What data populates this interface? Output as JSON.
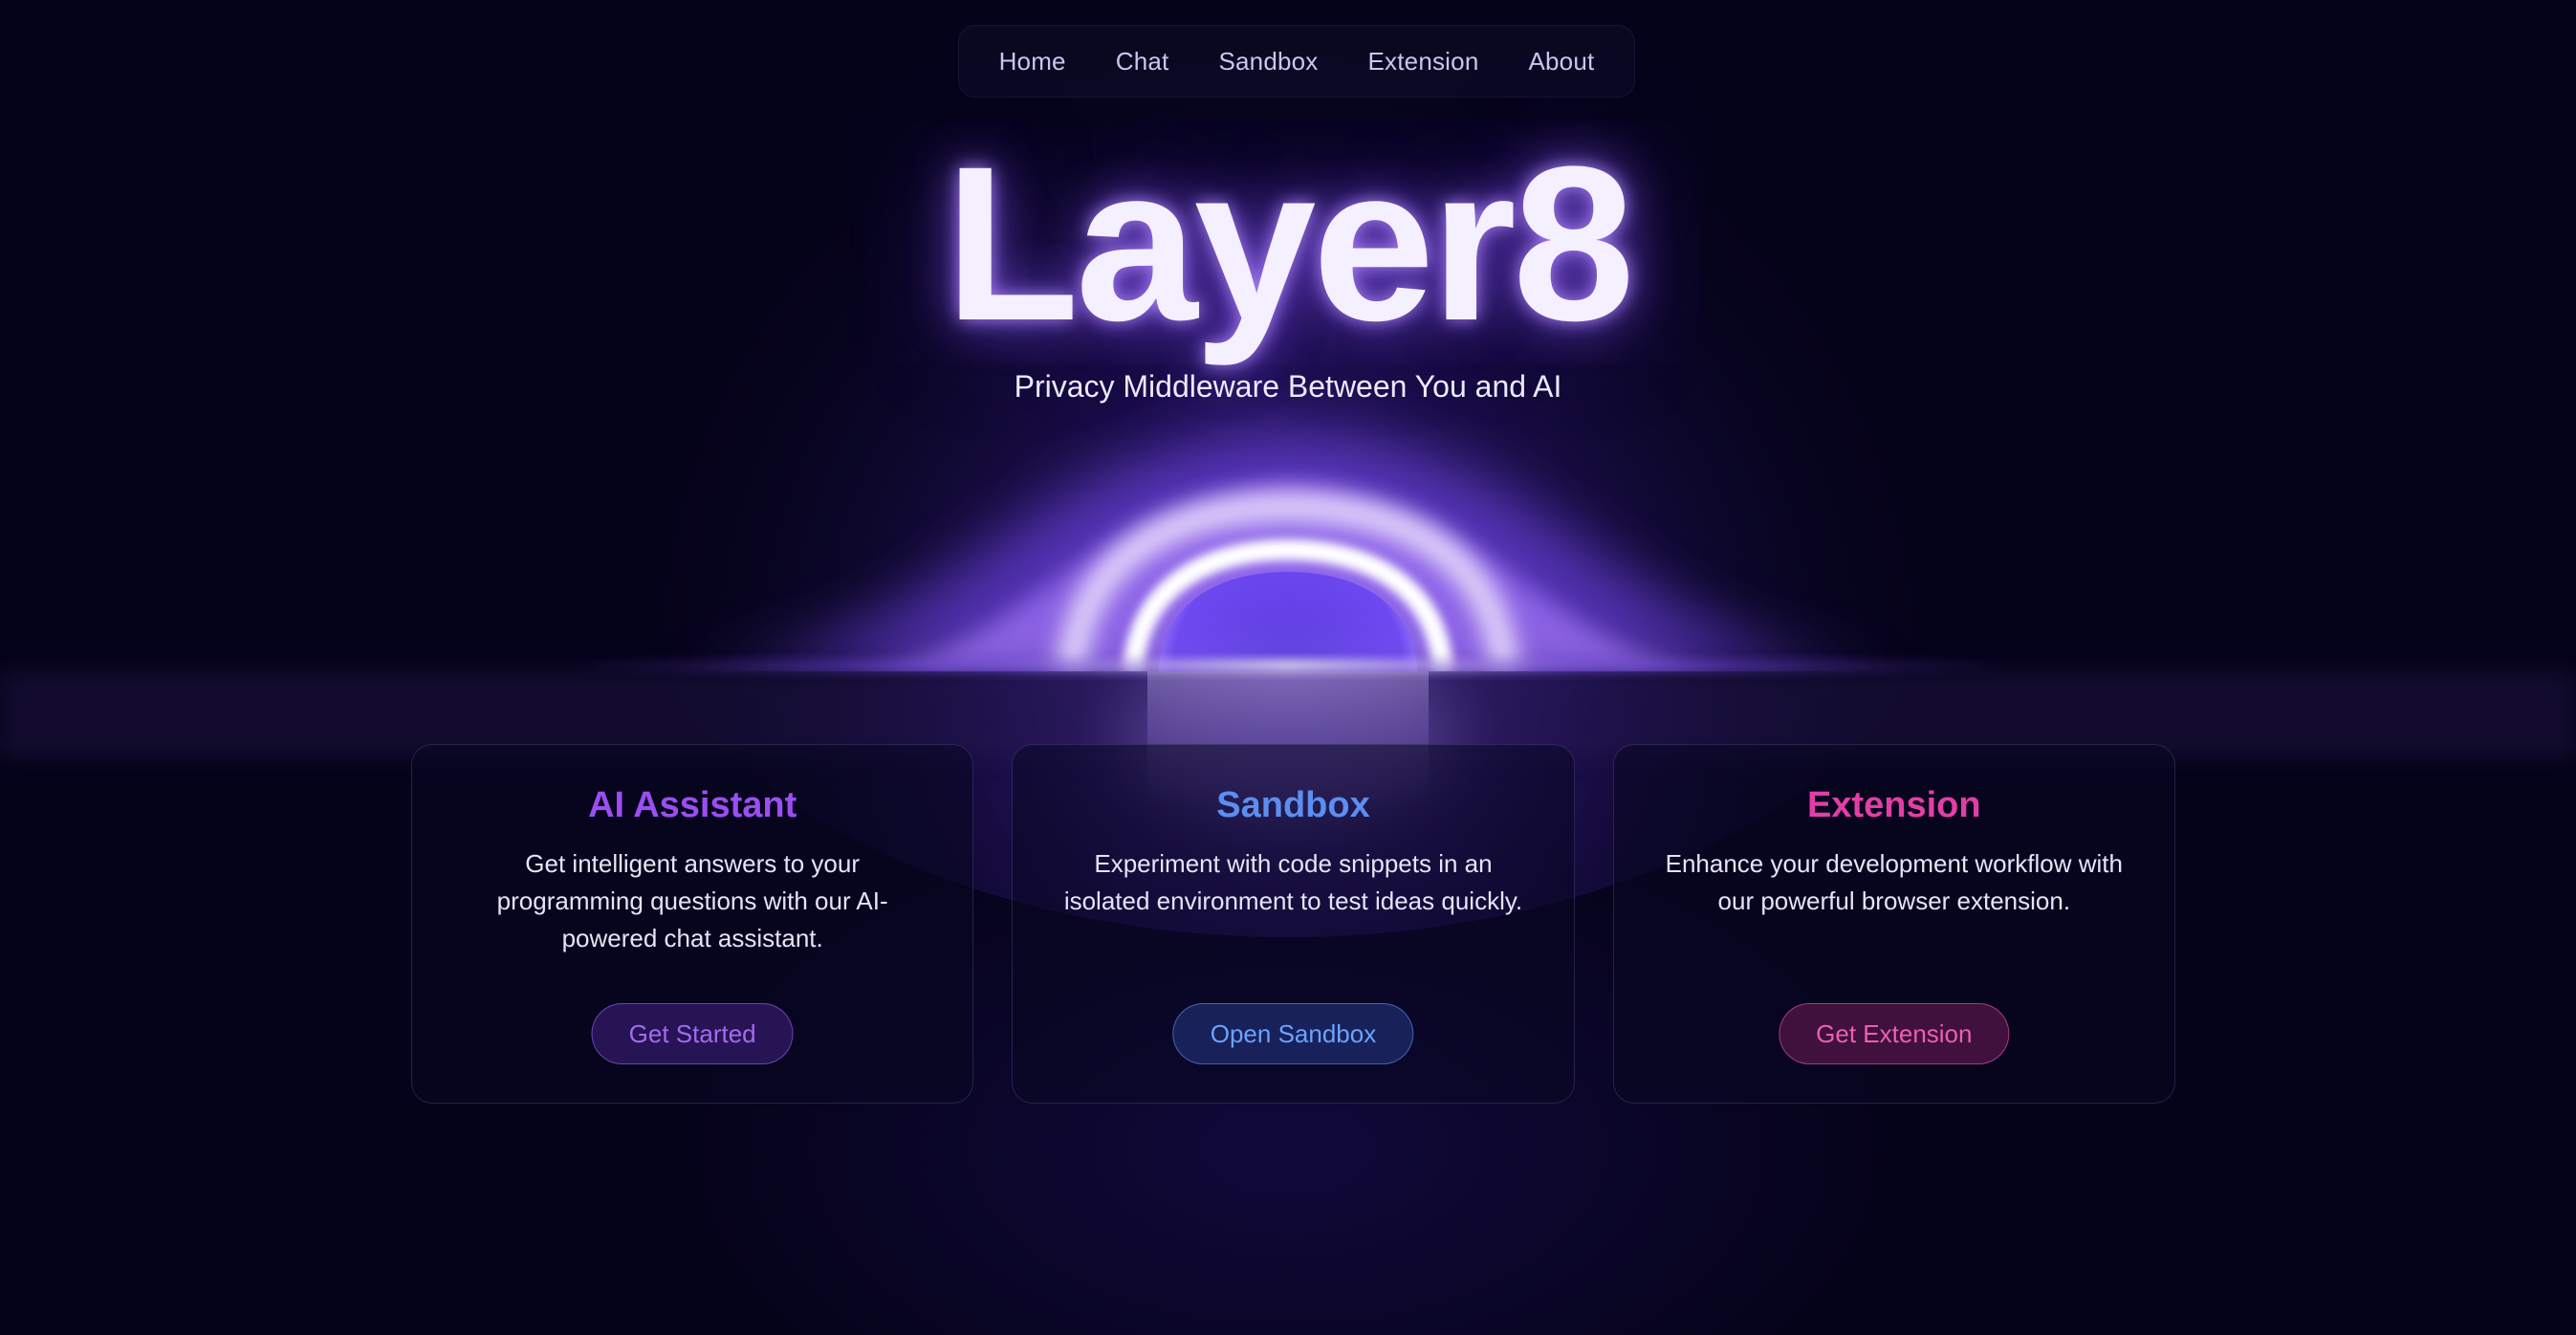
{
  "nav": {
    "items": [
      {
        "label": "Home"
      },
      {
        "label": "Chat"
      },
      {
        "label": "Sandbox"
      },
      {
        "label": "Extension"
      },
      {
        "label": "About"
      }
    ]
  },
  "hero": {
    "title": "Layer8",
    "subtitle": "Privacy Middleware Between You and AI"
  },
  "cards": [
    {
      "title": "AI Assistant",
      "description": "Get intelligent answers to your programming questions with our AI-powered chat assistant.",
      "button": "Get Started",
      "accent": "#9b4ef2"
    },
    {
      "title": "Sandbox",
      "description": "Experiment with code snippets in an isolated environment to test ideas quickly.",
      "button": "Open Sandbox",
      "accent": "#5b8ef0"
    },
    {
      "title": "Extension",
      "description": "Enhance your development workflow with our powerful browser extension.",
      "button": "Get Extension",
      "accent": "#e23ea6"
    }
  ],
  "colors": {
    "background": "#05031a",
    "glow": "#7b4dff"
  }
}
